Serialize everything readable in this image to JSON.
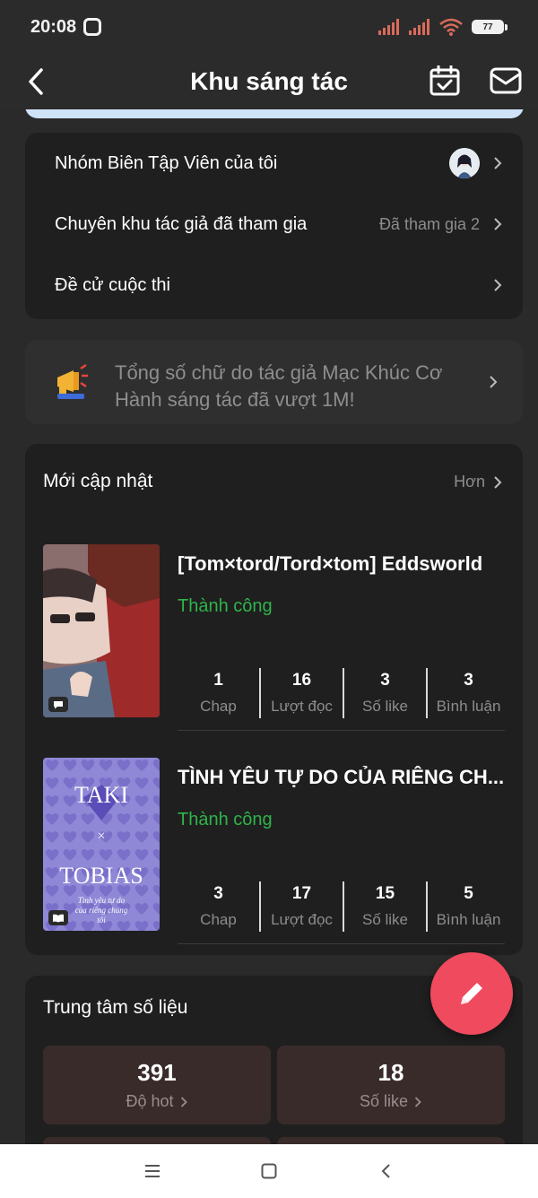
{
  "status_bar": {
    "time": "20:08",
    "battery": "77"
  },
  "header": {
    "title": "Khu sáng tác"
  },
  "menu": [
    {
      "label": "Nhóm Biên Tập Viên của tôi",
      "value": ""
    },
    {
      "label": "Chuyên khu tác giả đã tham gia",
      "value": "Đã tham gia 2"
    },
    {
      "label": "Đề cử cuộc thi",
      "value": ""
    }
  ],
  "notice": {
    "text": "Tổng số chữ do tác giả Mạc Khúc Cơ Hành sáng tác đã vượt 1M!"
  },
  "updates": {
    "title": "Mới cập nhật",
    "more": "Hơn",
    "books": [
      {
        "title": "[Tom×tord/Tord×tom] Eddsworld",
        "status": "Thành công",
        "stats": [
          {
            "num": "1",
            "label": "Chap"
          },
          {
            "num": "16",
            "label": "Lượt đọc"
          },
          {
            "num": "3",
            "label": "Số like"
          },
          {
            "num": "3",
            "label": "Bình luận"
          }
        ]
      },
      {
        "title": "TÌNH YÊU TỰ DO CỦA RIÊNG CH...",
        "status": "Thành công",
        "cover_text": [
          "TAKI",
          "×",
          "TOBIAS",
          "Tình yêu tự do",
          "của riêng chúng",
          "tôi"
        ],
        "stats": [
          {
            "num": "3",
            "label": "Chap"
          },
          {
            "num": "17",
            "label": "Lượt đọc"
          },
          {
            "num": "15",
            "label": "Số like"
          },
          {
            "num": "5",
            "label": "Bình luận"
          }
        ]
      }
    ]
  },
  "data_center": {
    "title": "Trung tâm số liệu",
    "boxes": [
      {
        "num": "391",
        "label": "Độ hot"
      },
      {
        "num": "18",
        "label": "Số like"
      }
    ]
  },
  "colors": {
    "accent_fab": "#ef4a5e",
    "success": "#2fb44a",
    "banner": "#cfe3f7"
  },
  "icons": [
    "back-icon",
    "calendar-check-icon",
    "mail-icon",
    "megaphone-icon",
    "pencil-icon",
    "menu-icon",
    "home-square-icon",
    "back-triangle-icon"
  ]
}
